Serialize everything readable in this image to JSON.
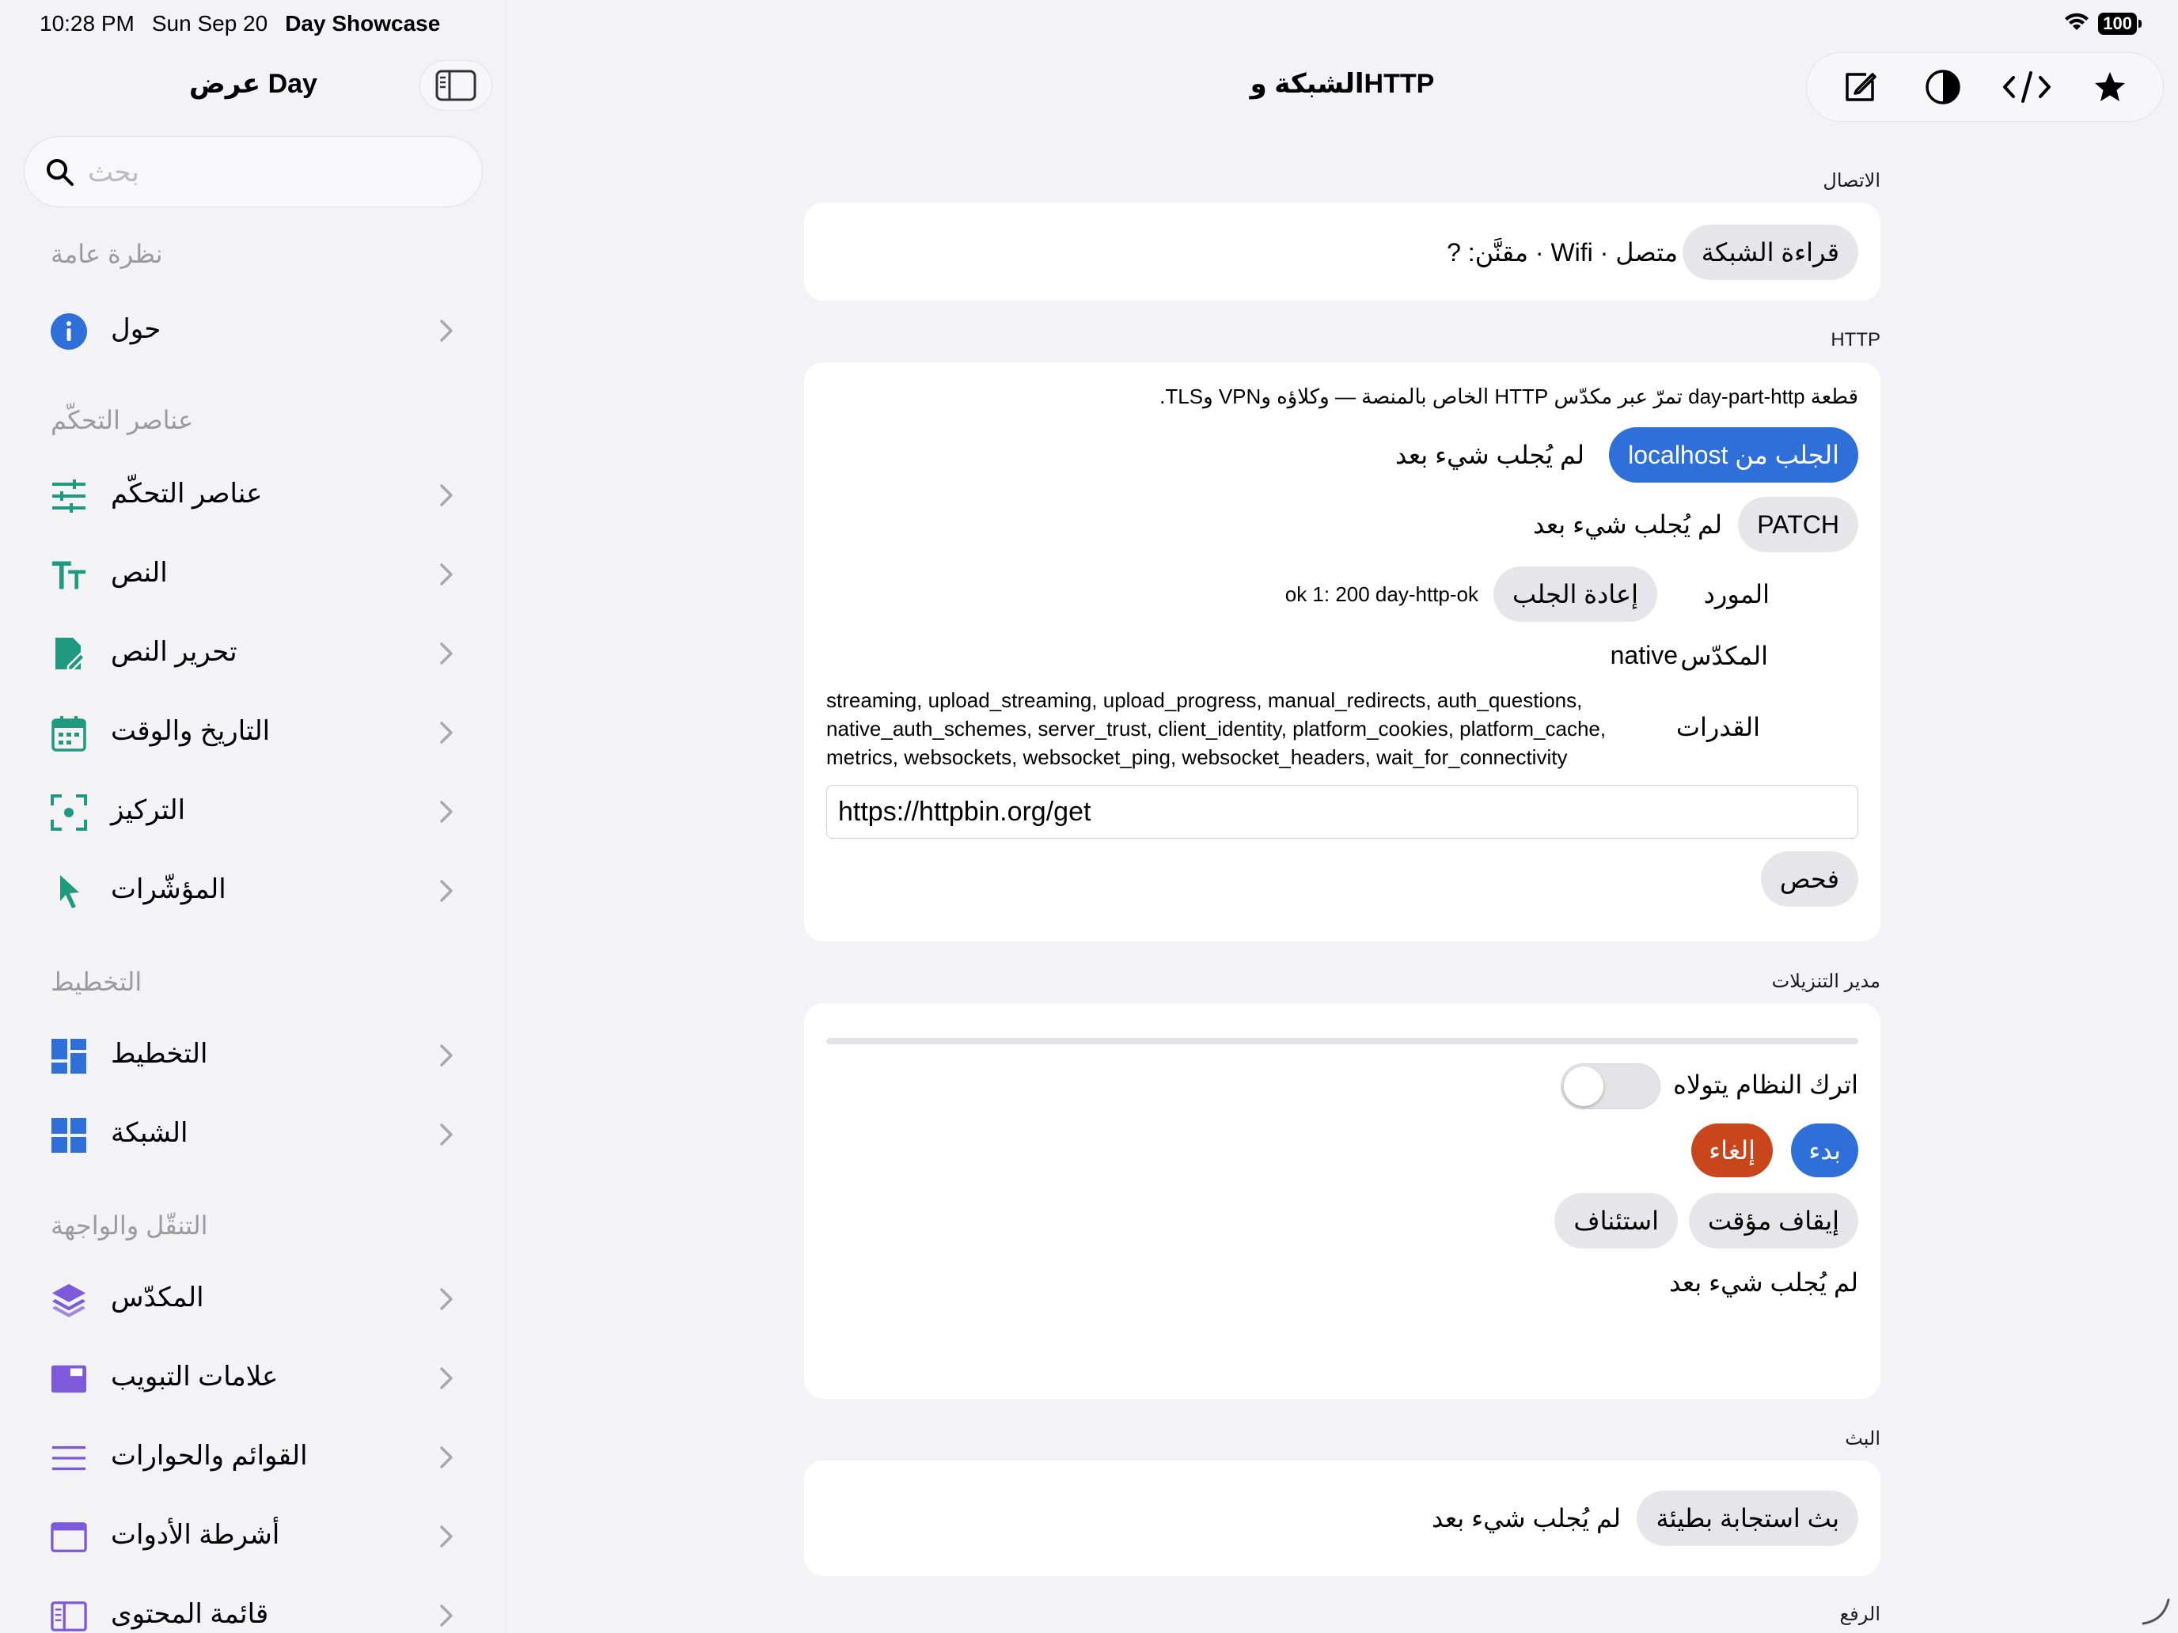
{
  "status_bar": {
    "time": "10:28 PM",
    "date": "Sun Sep 20",
    "app": "Day Showcase",
    "battery": "100"
  },
  "sidebar": {
    "title": "عرض Day",
    "search_placeholder": "بحث",
    "sections": {
      "overview": "نظرة عامة",
      "controls": "عناصر التحكّم",
      "layout": "التخطيط",
      "navigation": "التنقّل والواجهة"
    },
    "items": {
      "about": "حول",
      "controls": "عناصر التحكّم",
      "text": "النص",
      "text_editing": "تحرير النص",
      "date_time": "التاريخ والوقت",
      "focus": "التركيز",
      "pointers": "المؤشّرات",
      "layout": "التخطيط",
      "grid": "الشبكة",
      "stack": "المكدّس",
      "tabs": "علامات التبويب",
      "menus_dialogs": "القوائم والحوارات",
      "toolbars": "أشرطة الأدوات",
      "content_list": "قائمة المحتوى"
    },
    "colors": {
      "blue": "#2e6fd9",
      "teal": "#1f9a7e",
      "purple": "#7d5ad9"
    }
  },
  "main": {
    "title": "الشبكة وHTTP",
    "toolbar_icons": [
      "compose-icon",
      "contrast-icon",
      "code-icon",
      "star-icon"
    ],
    "connection": {
      "label": "الاتصال",
      "read_button": "قراءة الشبكة",
      "status_text": "متصل · Wifi · مقنَّن: ?"
    },
    "http": {
      "label": "HTTP",
      "description": "قطعة day-part-http تمرّ عبر مكدّس HTTP الخاص بالمنصة — وكلاؤه وVPN وTLS.",
      "fetch_localhost_button": "الجلب من localhost",
      "fetch_localhost_result": "لم يُجلب شيء بعد",
      "patch_button": "PATCH",
      "patch_result": "لم يُجلب شيء بعد",
      "resource_label": "المورد",
      "refetch_button": "إعادة الجلب",
      "resource_value": "ok 1: 200 day-http-ok",
      "stack_label": "المكدّس",
      "stack_value": "native",
      "capabilities_label": "القدرات",
      "capabilities_line1": "streaming, upload_streaming, upload_progress, manual_redirects, auth_questions,",
      "capabilities_line2": "native_auth_schemes, server_trust, client_identity, platform_cookies, platform_cache,",
      "capabilities_line3": "metrics, websockets, websocket_ping, websocket_headers, wait_for_connectivity",
      "url_value": "https://httpbin.org/get",
      "inspect_button": "فحص"
    },
    "downloads": {
      "label": "مدير التنزيلات",
      "progress": 0,
      "let_system_label": "اترك النظام يتولاه",
      "let_system_on": false,
      "start_button": "بدء",
      "cancel_button": "إلغاء",
      "pause_button": "إيقاف مؤقت",
      "resume_button": "استئناف",
      "status_text": "لم يُجلب شيء بعد"
    },
    "streaming": {
      "label": "البث",
      "stream_button": "بث استجابة بطيئة",
      "status_text": "لم يُجلب شيء بعد"
    },
    "upload": {
      "label": "الرفع"
    }
  }
}
